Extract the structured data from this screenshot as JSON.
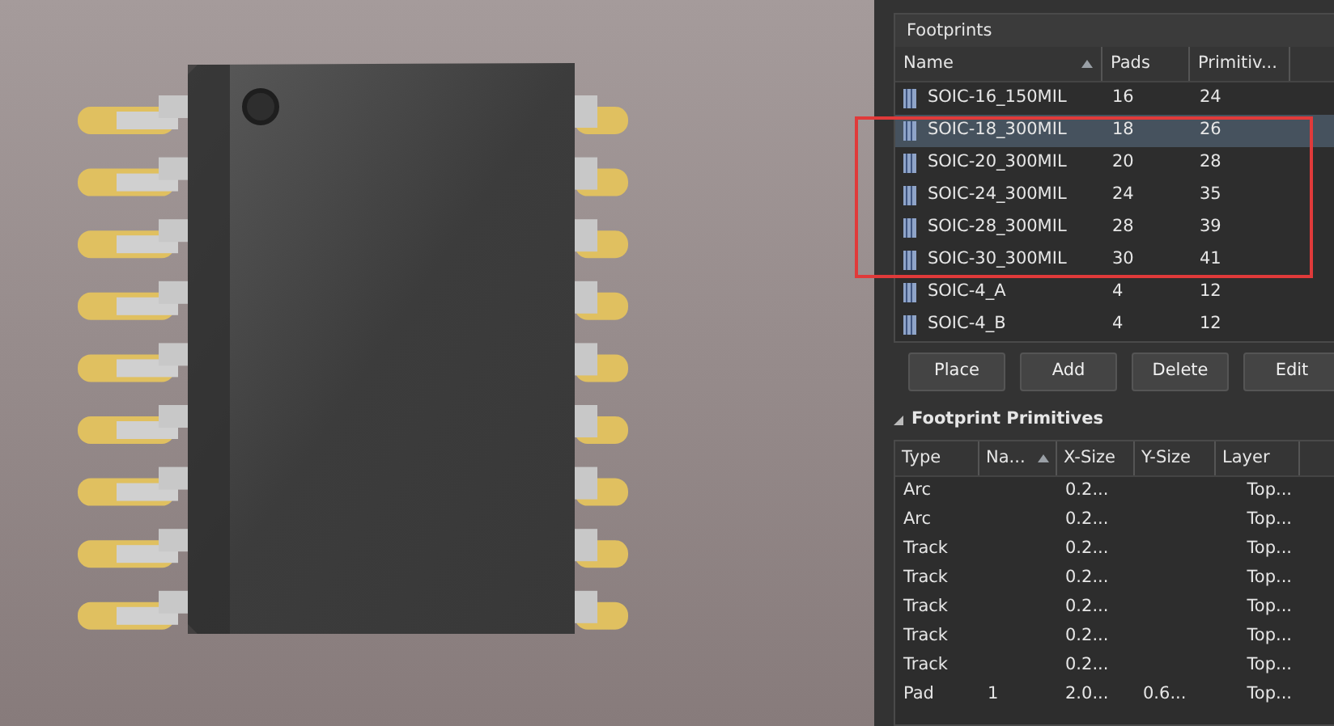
{
  "footprints": {
    "title": "Footprints",
    "columns": [
      {
        "label": "Name",
        "sorted": true
      },
      {
        "label": "Pads",
        "sorted": false
      },
      {
        "label": "Primitiv...",
        "sorted": false
      }
    ],
    "rows": [
      {
        "name": "SOIC-16_150MIL",
        "pads": "16",
        "primitives": "24",
        "selected": false
      },
      {
        "name": "SOIC-18_300MIL",
        "pads": "18",
        "primitives": "26",
        "selected": true
      },
      {
        "name": "SOIC-20_300MIL",
        "pads": "20",
        "primitives": "28",
        "selected": false
      },
      {
        "name": "SOIC-24_300MIL",
        "pads": "24",
        "primitives": "35",
        "selected": false
      },
      {
        "name": "SOIC-28_300MIL",
        "pads": "28",
        "primitives": "39",
        "selected": false
      },
      {
        "name": "SOIC-30_300MIL",
        "pads": "30",
        "primitives": "41",
        "selected": false
      },
      {
        "name": "SOIC-4_A",
        "pads": "4",
        "primitives": "12",
        "selected": false
      },
      {
        "name": "SOIC-4_B",
        "pads": "4",
        "primitives": "12",
        "selected": false
      }
    ],
    "buttons": [
      "Place",
      "Add",
      "Delete",
      "Edit"
    ]
  },
  "primitives": {
    "title": "Footprint Primitives",
    "expanded": true,
    "columns": [
      {
        "label": "Type",
        "sorted": false
      },
      {
        "label": "Na...",
        "sorted": true
      },
      {
        "label": "X-Size",
        "sorted": false
      },
      {
        "label": "Y-Size",
        "sorted": false
      },
      {
        "label": "Layer",
        "sorted": false
      }
    ],
    "rows": [
      [
        "Arc",
        "",
        "0.2...",
        "",
        "Top..."
      ],
      [
        "Arc",
        "",
        "0.2...",
        "",
        "Top..."
      ],
      [
        "Track",
        "",
        "0.2...",
        "",
        "Top..."
      ],
      [
        "Track",
        "",
        "0.2...",
        "",
        "Top..."
      ],
      [
        "Track",
        "",
        "0.2...",
        "",
        "Top..."
      ],
      [
        "Track",
        "",
        "0.2...",
        "",
        "Top..."
      ],
      [
        "Track",
        "",
        "0.2...",
        "",
        "Top..."
      ],
      [
        "Pad",
        "1",
        "2.0...",
        "0.6...",
        "Top..."
      ]
    ]
  }
}
